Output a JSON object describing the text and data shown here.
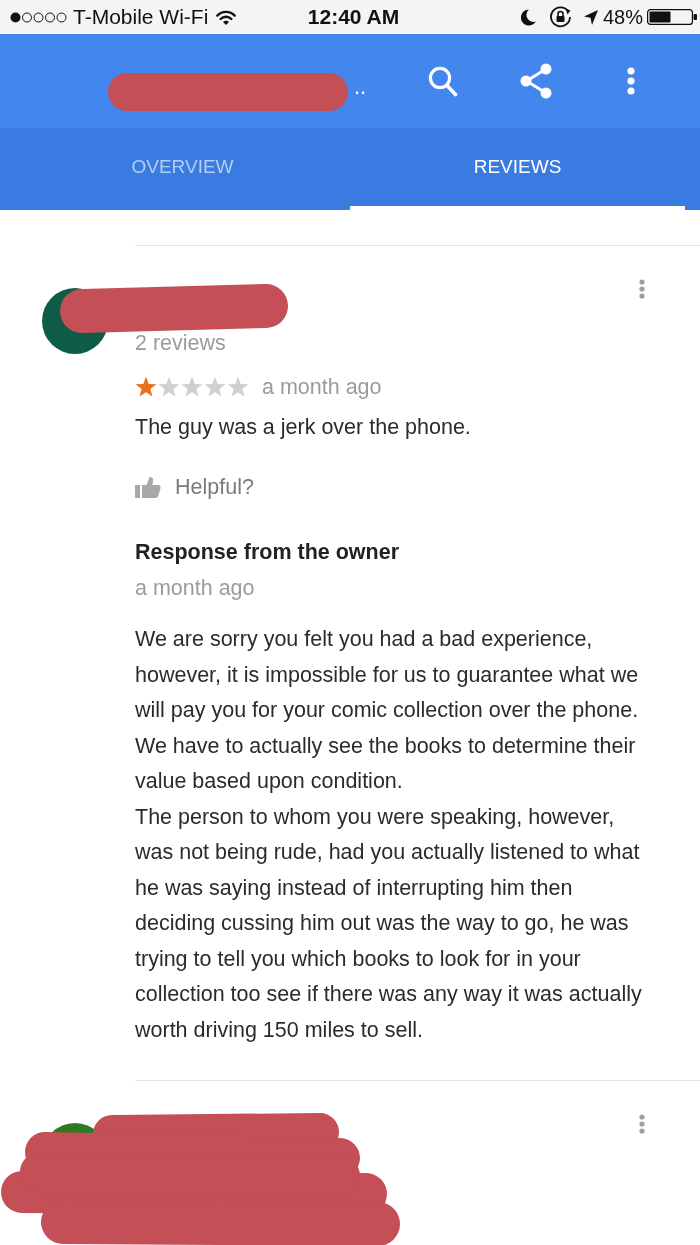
{
  "status_bar": {
    "carrier": "T-Mobile Wi-Fi",
    "time": "12:40 AM",
    "battery": "48%"
  },
  "toolbar": {
    "title": "..",
    "redacted": true
  },
  "tabs": [
    {
      "label": "OVERVIEW",
      "selected": false
    },
    {
      "label": "REVIEWS",
      "selected": true
    }
  ],
  "reviews": [
    {
      "color": "#0e5b48",
      "redacted": true,
      "review_count": "2 reviews",
      "stars": 1,
      "time": "a month ago",
      "text": "The guy was a jerk over the phone.",
      "helpful": "Helpful?",
      "owner_response": {
        "title": "Response from the owner",
        "time": "a month ago",
        "paragraphs": [
          "We are sorry you felt you had a bad experience, however, it is impossible for us to guarantee what we will pay you for your comic collection over the phone. We have to actually see the books to determine their value based upon condition.",
          "The person to whom you were speaking, however, was not being rude, had you actually listened to what he was saying instead of interrupting him then deciding cussing him out was the way to go, he was trying to tell you which books to look for in your collection too see if there was any way it was actually worth driving 150 miles to sell."
        ]
      }
    },
    {
      "color": "#2e7a22",
      "redacted": true
    }
  ]
}
